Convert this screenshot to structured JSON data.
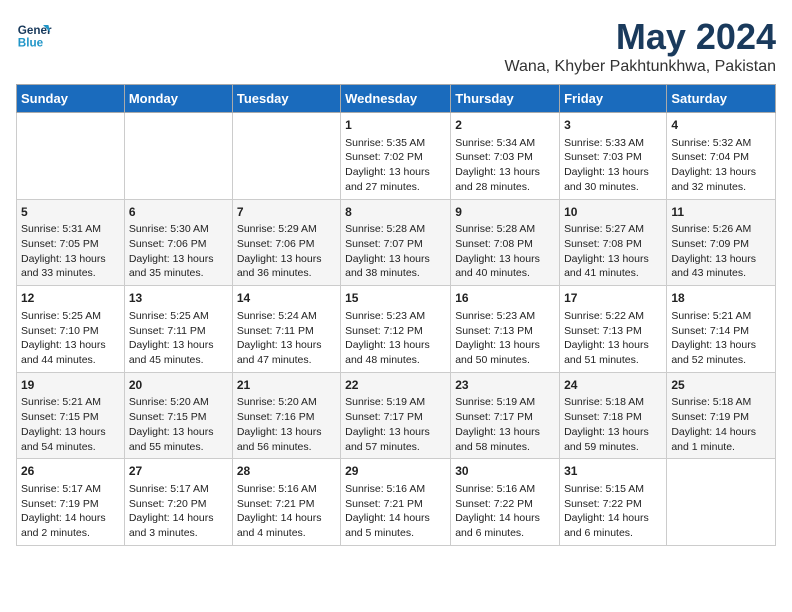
{
  "header": {
    "logo_line1": "General",
    "logo_line2": "Blue",
    "month": "May 2024",
    "location": "Wana, Khyber Pakhtunkhwa, Pakistan"
  },
  "weekdays": [
    "Sunday",
    "Monday",
    "Tuesday",
    "Wednesday",
    "Thursday",
    "Friday",
    "Saturday"
  ],
  "weeks": [
    [
      {
        "day": "",
        "sunrise": "",
        "sunset": "",
        "daylight": ""
      },
      {
        "day": "",
        "sunrise": "",
        "sunset": "",
        "daylight": ""
      },
      {
        "day": "",
        "sunrise": "",
        "sunset": "",
        "daylight": ""
      },
      {
        "day": "1",
        "sunrise": "Sunrise: 5:35 AM",
        "sunset": "Sunset: 7:02 PM",
        "daylight": "Daylight: 13 hours and 27 minutes."
      },
      {
        "day": "2",
        "sunrise": "Sunrise: 5:34 AM",
        "sunset": "Sunset: 7:03 PM",
        "daylight": "Daylight: 13 hours and 28 minutes."
      },
      {
        "day": "3",
        "sunrise": "Sunrise: 5:33 AM",
        "sunset": "Sunset: 7:03 PM",
        "daylight": "Daylight: 13 hours and 30 minutes."
      },
      {
        "day": "4",
        "sunrise": "Sunrise: 5:32 AM",
        "sunset": "Sunset: 7:04 PM",
        "daylight": "Daylight: 13 hours and 32 minutes."
      }
    ],
    [
      {
        "day": "5",
        "sunrise": "Sunrise: 5:31 AM",
        "sunset": "Sunset: 7:05 PM",
        "daylight": "Daylight: 13 hours and 33 minutes."
      },
      {
        "day": "6",
        "sunrise": "Sunrise: 5:30 AM",
        "sunset": "Sunset: 7:06 PM",
        "daylight": "Daylight: 13 hours and 35 minutes."
      },
      {
        "day": "7",
        "sunrise": "Sunrise: 5:29 AM",
        "sunset": "Sunset: 7:06 PM",
        "daylight": "Daylight: 13 hours and 36 minutes."
      },
      {
        "day": "8",
        "sunrise": "Sunrise: 5:28 AM",
        "sunset": "Sunset: 7:07 PM",
        "daylight": "Daylight: 13 hours and 38 minutes."
      },
      {
        "day": "9",
        "sunrise": "Sunrise: 5:28 AM",
        "sunset": "Sunset: 7:08 PM",
        "daylight": "Daylight: 13 hours and 40 minutes."
      },
      {
        "day": "10",
        "sunrise": "Sunrise: 5:27 AM",
        "sunset": "Sunset: 7:08 PM",
        "daylight": "Daylight: 13 hours and 41 minutes."
      },
      {
        "day": "11",
        "sunrise": "Sunrise: 5:26 AM",
        "sunset": "Sunset: 7:09 PM",
        "daylight": "Daylight: 13 hours and 43 minutes."
      }
    ],
    [
      {
        "day": "12",
        "sunrise": "Sunrise: 5:25 AM",
        "sunset": "Sunset: 7:10 PM",
        "daylight": "Daylight: 13 hours and 44 minutes."
      },
      {
        "day": "13",
        "sunrise": "Sunrise: 5:25 AM",
        "sunset": "Sunset: 7:11 PM",
        "daylight": "Daylight: 13 hours and 45 minutes."
      },
      {
        "day": "14",
        "sunrise": "Sunrise: 5:24 AM",
        "sunset": "Sunset: 7:11 PM",
        "daylight": "Daylight: 13 hours and 47 minutes."
      },
      {
        "day": "15",
        "sunrise": "Sunrise: 5:23 AM",
        "sunset": "Sunset: 7:12 PM",
        "daylight": "Daylight: 13 hours and 48 minutes."
      },
      {
        "day": "16",
        "sunrise": "Sunrise: 5:23 AM",
        "sunset": "Sunset: 7:13 PM",
        "daylight": "Daylight: 13 hours and 50 minutes."
      },
      {
        "day": "17",
        "sunrise": "Sunrise: 5:22 AM",
        "sunset": "Sunset: 7:13 PM",
        "daylight": "Daylight: 13 hours and 51 minutes."
      },
      {
        "day": "18",
        "sunrise": "Sunrise: 5:21 AM",
        "sunset": "Sunset: 7:14 PM",
        "daylight": "Daylight: 13 hours and 52 minutes."
      }
    ],
    [
      {
        "day": "19",
        "sunrise": "Sunrise: 5:21 AM",
        "sunset": "Sunset: 7:15 PM",
        "daylight": "Daylight: 13 hours and 54 minutes."
      },
      {
        "day": "20",
        "sunrise": "Sunrise: 5:20 AM",
        "sunset": "Sunset: 7:15 PM",
        "daylight": "Daylight: 13 hours and 55 minutes."
      },
      {
        "day": "21",
        "sunrise": "Sunrise: 5:20 AM",
        "sunset": "Sunset: 7:16 PM",
        "daylight": "Daylight: 13 hours and 56 minutes."
      },
      {
        "day": "22",
        "sunrise": "Sunrise: 5:19 AM",
        "sunset": "Sunset: 7:17 PM",
        "daylight": "Daylight: 13 hours and 57 minutes."
      },
      {
        "day": "23",
        "sunrise": "Sunrise: 5:19 AM",
        "sunset": "Sunset: 7:17 PM",
        "daylight": "Daylight: 13 hours and 58 minutes."
      },
      {
        "day": "24",
        "sunrise": "Sunrise: 5:18 AM",
        "sunset": "Sunset: 7:18 PM",
        "daylight": "Daylight: 13 hours and 59 minutes."
      },
      {
        "day": "25",
        "sunrise": "Sunrise: 5:18 AM",
        "sunset": "Sunset: 7:19 PM",
        "daylight": "Daylight: 14 hours and 1 minute."
      }
    ],
    [
      {
        "day": "26",
        "sunrise": "Sunrise: 5:17 AM",
        "sunset": "Sunset: 7:19 PM",
        "daylight": "Daylight: 14 hours and 2 minutes."
      },
      {
        "day": "27",
        "sunrise": "Sunrise: 5:17 AM",
        "sunset": "Sunset: 7:20 PM",
        "daylight": "Daylight: 14 hours and 3 minutes."
      },
      {
        "day": "28",
        "sunrise": "Sunrise: 5:16 AM",
        "sunset": "Sunset: 7:21 PM",
        "daylight": "Daylight: 14 hours and 4 minutes."
      },
      {
        "day": "29",
        "sunrise": "Sunrise: 5:16 AM",
        "sunset": "Sunset: 7:21 PM",
        "daylight": "Daylight: 14 hours and 5 minutes."
      },
      {
        "day": "30",
        "sunrise": "Sunrise: 5:16 AM",
        "sunset": "Sunset: 7:22 PM",
        "daylight": "Daylight: 14 hours and 6 minutes."
      },
      {
        "day": "31",
        "sunrise": "Sunrise: 5:15 AM",
        "sunset": "Sunset: 7:22 PM",
        "daylight": "Daylight: 14 hours and 6 minutes."
      },
      {
        "day": "",
        "sunrise": "",
        "sunset": "",
        "daylight": ""
      }
    ]
  ]
}
